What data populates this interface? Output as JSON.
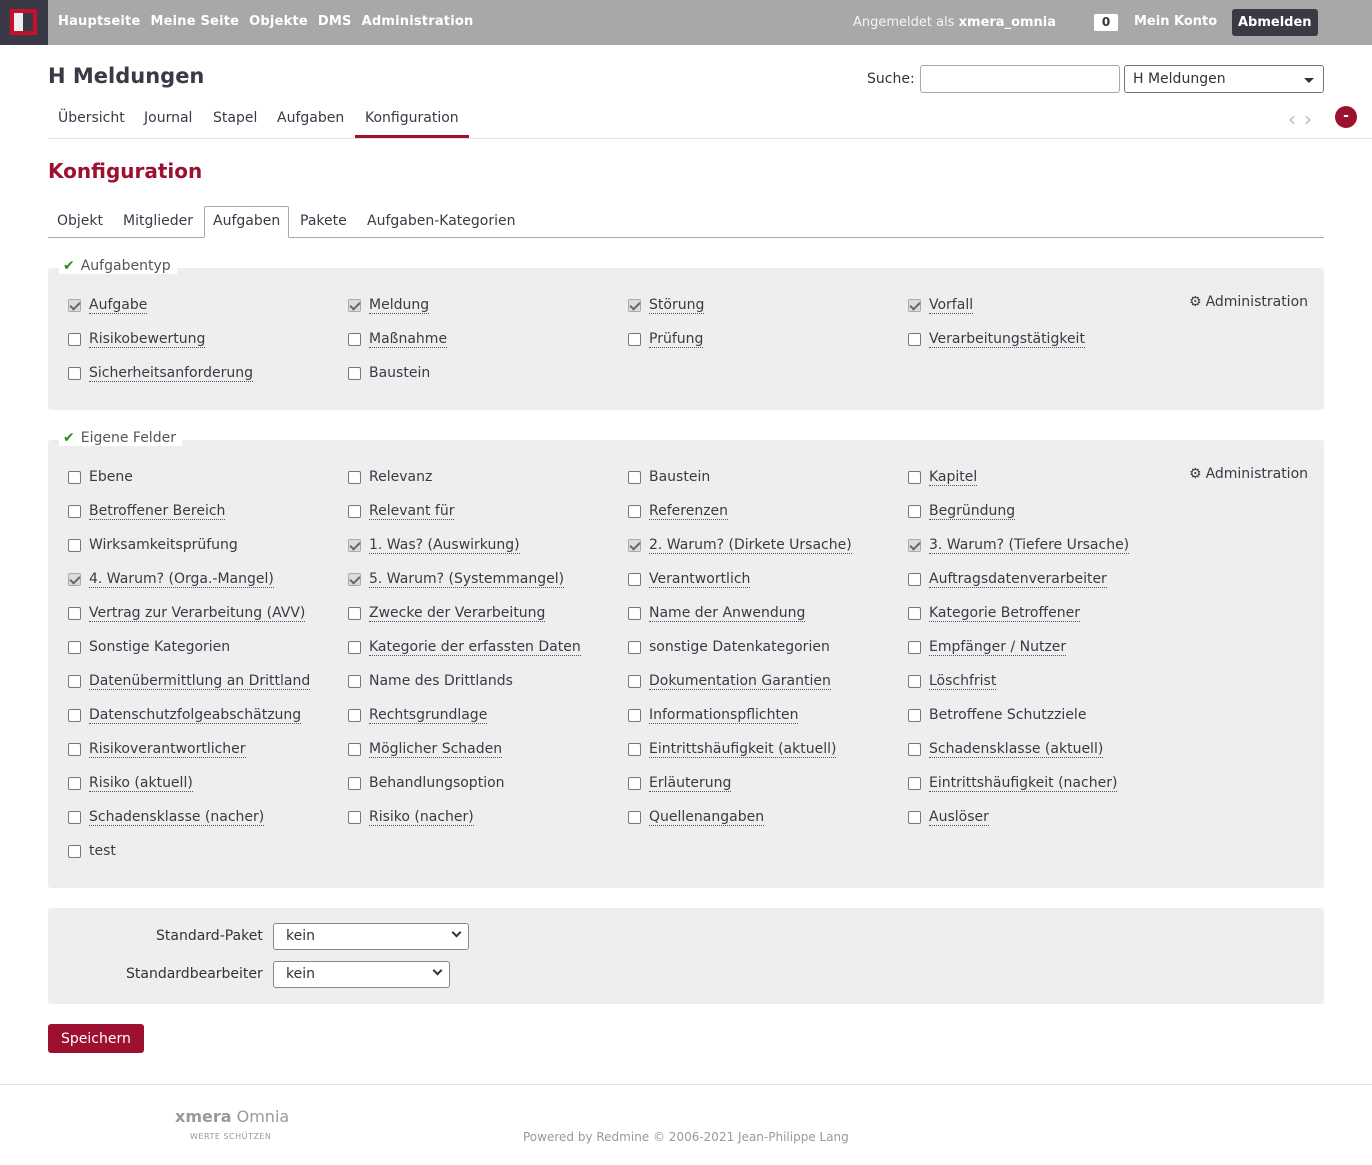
{
  "topbar": {
    "nav": [
      "Hauptseite",
      "Meine Seite",
      "Objekte",
      "DMS",
      "Administration"
    ],
    "login_prefix": "Angemeldet als",
    "login_user": "xmera_omnia",
    "badge_count": "0",
    "account": "Mein Konto",
    "logout": "Abmelden"
  },
  "header": {
    "title": "H Meldungen",
    "search_label": "Suche:",
    "search_value": "",
    "project_select": "H Meldungen"
  },
  "main_tabs": [
    "Übersicht",
    "Journal",
    "Stapel",
    "Aufgaben",
    "Konfiguration"
  ],
  "main_tabs_active": "Konfiguration",
  "settings": {
    "heading": "Konfiguration",
    "tabs": [
      "Objekt",
      "Mitglieder",
      "Aufgaben",
      "Pakete",
      "Aufgaben-Kategorien"
    ],
    "active_tab": "Aufgaben"
  },
  "tracker_section": {
    "legend": "Aufgabentyp",
    "admin_link": "Administration",
    "items": [
      {
        "label": "Aufgabe",
        "checked": true,
        "link": true
      },
      {
        "label": "Meldung",
        "checked": true,
        "link": true
      },
      {
        "label": "Störung",
        "checked": true,
        "link": true
      },
      {
        "label": "Vorfall",
        "checked": true,
        "link": true
      },
      {
        "label": "Risikobewertung",
        "checked": false,
        "link": true
      },
      {
        "label": "Maßnahme",
        "checked": false,
        "link": true
      },
      {
        "label": "Prüfung",
        "checked": false,
        "link": true
      },
      {
        "label": "Verarbeitungstätigkeit",
        "checked": false,
        "link": true
      },
      {
        "label": "Sicherheitsanforderung",
        "checked": false,
        "link": true
      },
      {
        "label": "Baustein",
        "checked": false,
        "link": false
      }
    ]
  },
  "fields_section": {
    "legend": "Eigene Felder",
    "admin_link": "Administration",
    "items": [
      {
        "label": "Ebene",
        "checked": false,
        "link": false
      },
      {
        "label": "Relevanz",
        "checked": false,
        "link": false
      },
      {
        "label": "Baustein",
        "checked": false,
        "link": false
      },
      {
        "label": "Kapitel",
        "checked": false,
        "link": true
      },
      {
        "label": "Betroffener Bereich",
        "checked": false,
        "link": true
      },
      {
        "label": "Relevant für",
        "checked": false,
        "link": true
      },
      {
        "label": "Referenzen",
        "checked": false,
        "link": true
      },
      {
        "label": "Begründung",
        "checked": false,
        "link": true
      },
      {
        "label": "Wirksamkeitsprüfung",
        "checked": false,
        "link": false
      },
      {
        "label": "1. Was? (Auswirkung)",
        "checked": true,
        "link": true
      },
      {
        "label": "2. Warum? (Dirkete Ursache)",
        "checked": true,
        "link": true
      },
      {
        "label": "3. Warum? (Tiefere Ursache)",
        "checked": true,
        "link": true
      },
      {
        "label": "4. Warum? (Orga.-Mangel)",
        "checked": true,
        "link": true
      },
      {
        "label": "5. Warum? (Systemmangel)",
        "checked": true,
        "link": true
      },
      {
        "label": "Verantwortlich",
        "checked": false,
        "link": true
      },
      {
        "label": "Auftragsdatenverarbeiter",
        "checked": false,
        "link": true
      },
      {
        "label": "Vertrag zur Verarbeitung (AVV)",
        "checked": false,
        "link": true
      },
      {
        "label": "Zwecke der Verarbeitung",
        "checked": false,
        "link": true
      },
      {
        "label": "Name der Anwendung",
        "checked": false,
        "link": true
      },
      {
        "label": "Kategorie Betroffener",
        "checked": false,
        "link": true
      },
      {
        "label": "Sonstige Kategorien",
        "checked": false,
        "link": false
      },
      {
        "label": "Kategorie der erfassten Daten",
        "checked": false,
        "link": true
      },
      {
        "label": "sonstige Datenkategorien",
        "checked": false,
        "link": false
      },
      {
        "label": "Empfänger / Nutzer",
        "checked": false,
        "link": true
      },
      {
        "label": "Datenübermittlung an Drittland",
        "checked": false,
        "link": true
      },
      {
        "label": "Name des Drittlands",
        "checked": false,
        "link": false
      },
      {
        "label": "Dokumentation Garantien",
        "checked": false,
        "link": true
      },
      {
        "label": "Löschfrist",
        "checked": false,
        "link": true
      },
      {
        "label": "Datenschutzfolgeabschätzung",
        "checked": false,
        "link": true
      },
      {
        "label": "Rechtsgrundlage",
        "checked": false,
        "link": true
      },
      {
        "label": "Informationspflichten",
        "checked": false,
        "link": true
      },
      {
        "label": "Betroffene Schutzziele",
        "checked": false,
        "link": false
      },
      {
        "label": "Risikoverantwortlicher",
        "checked": false,
        "link": true
      },
      {
        "label": "Möglicher Schaden",
        "checked": false,
        "link": true
      },
      {
        "label": "Eintrittshäufigkeit (aktuell)",
        "checked": false,
        "link": true
      },
      {
        "label": "Schadensklasse (aktuell)",
        "checked": false,
        "link": true
      },
      {
        "label": "Risiko (aktuell)",
        "checked": false,
        "link": true
      },
      {
        "label": "Behandlungsoption",
        "checked": false,
        "link": false
      },
      {
        "label": "Erläuterung",
        "checked": false,
        "link": true
      },
      {
        "label": "Eintrittshäufigkeit (nacher)",
        "checked": false,
        "link": true
      },
      {
        "label": "Schadensklasse (nacher)",
        "checked": false,
        "link": true
      },
      {
        "label": "Risiko (nacher)",
        "checked": false,
        "link": true
      },
      {
        "label": "Quellenangaben",
        "checked": false,
        "link": true
      },
      {
        "label": "Auslöser",
        "checked": false,
        "link": true
      },
      {
        "label": "test",
        "checked": false,
        "link": false
      }
    ]
  },
  "defaults": {
    "package_label": "Standard-Paket",
    "package_value": "kein",
    "assignee_label": "Standardbearbeiter",
    "assignee_value": "kein"
  },
  "save_button": "Speichern",
  "footer": {
    "brand_bold": "xmera",
    "brand_rest": "Omnia",
    "tagline": "WERTE SCHÜTZEN",
    "powered": "Powered by Redmine © 2006-2021 Jean-Philippe Lang"
  }
}
